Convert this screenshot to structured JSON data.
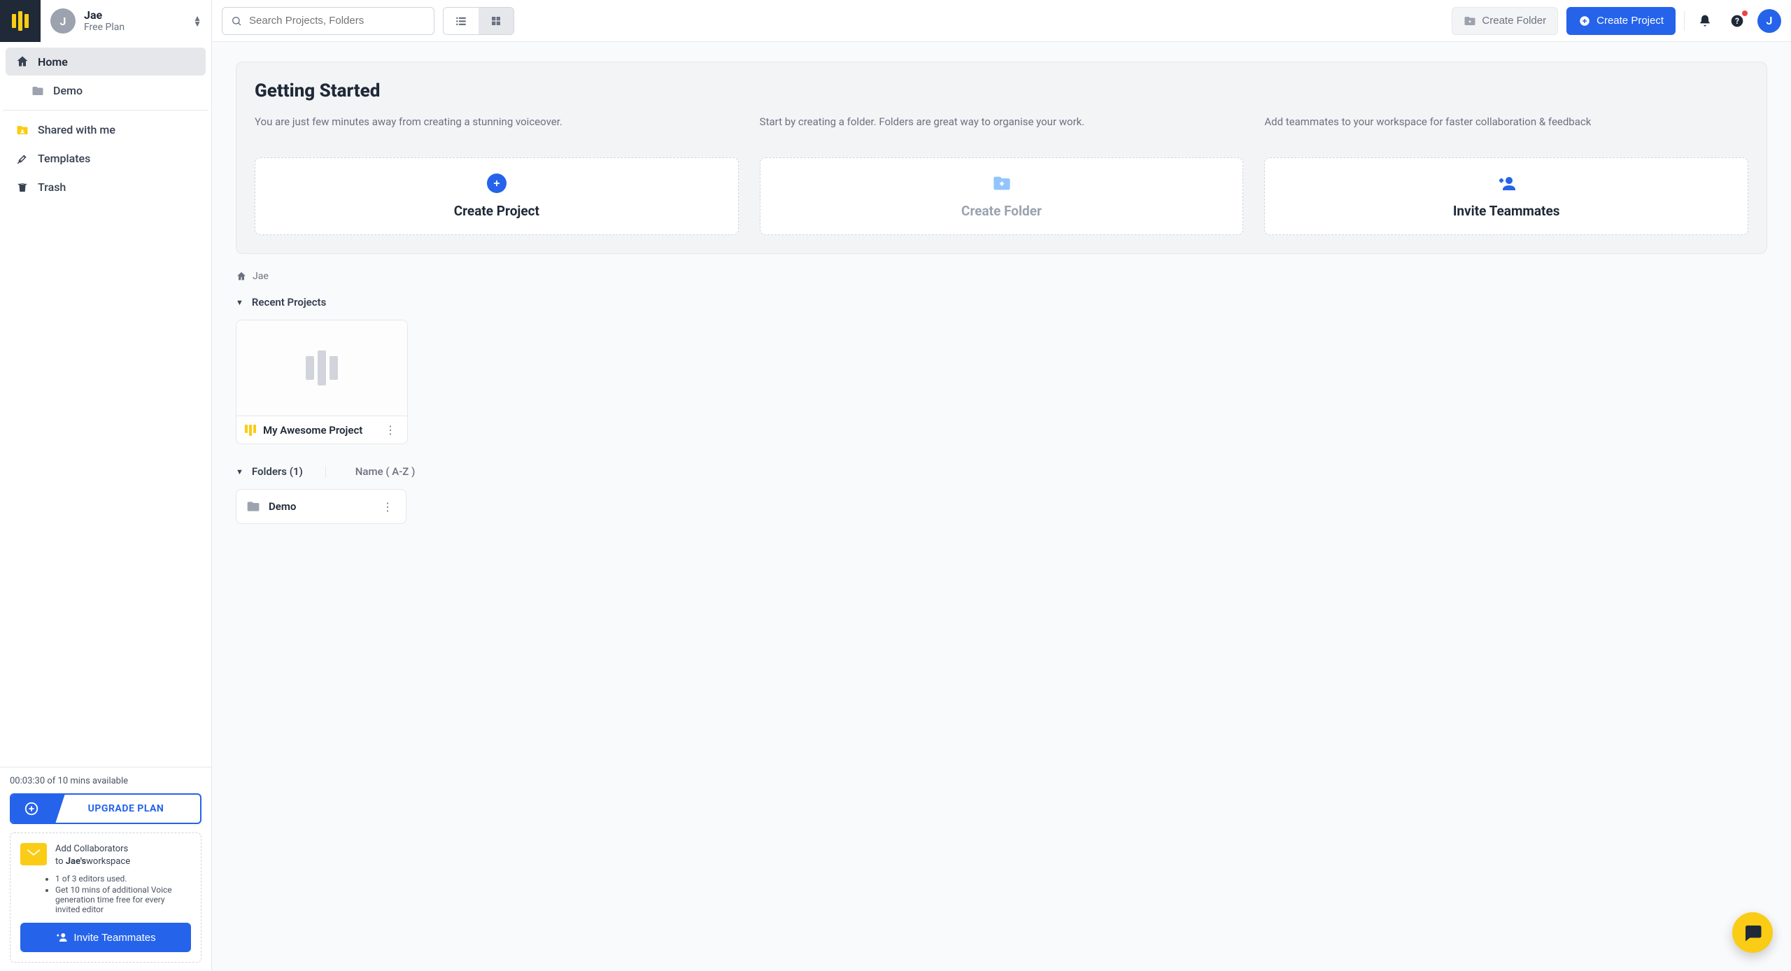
{
  "user": {
    "name": "Jae",
    "plan": "Free Plan",
    "initial": "J"
  },
  "nav": {
    "home": "Home",
    "demo": "Demo",
    "shared": "Shared with me",
    "templates": "Templates",
    "trash": "Trash"
  },
  "quota": "00:03:30 of 10 mins available",
  "upgrade": "UPGRADE PLAN",
  "collab": {
    "line1": "Add Collaborators",
    "line2_pre": "to ",
    "line2_b": "Jae's",
    "line2_post": "workspace",
    "bullet1": "1 of 3 editors used.",
    "bullet2": "Get 10 mins of additional Voice generation time free for every invited editor",
    "invite": "Invite Teammates"
  },
  "search": {
    "placeholder": "Search Projects, Folders"
  },
  "topbar": {
    "create_folder": "Create Folder",
    "create_project": "Create Project",
    "avatar_initial": "J"
  },
  "gs": {
    "title": "Getting Started",
    "c1_desc": "You are just few minutes away from creating a stunning voiceover.",
    "c1_title": "Create Project",
    "c2_desc": "Start by creating a folder. Folders are great way to organise your work.",
    "c2_title": "Create Folder",
    "c3_desc": "Add teammates to your workspace for faster collaboration & feedback",
    "c3_title": "Invite Teammates"
  },
  "breadcrumb": {
    "home": "Jae"
  },
  "sections": {
    "recent": "Recent Projects",
    "folders": "Folders (1)",
    "sort": "Name ( A-Z )"
  },
  "project": {
    "name": "My Awesome Project"
  },
  "folder": {
    "name": "Demo"
  }
}
